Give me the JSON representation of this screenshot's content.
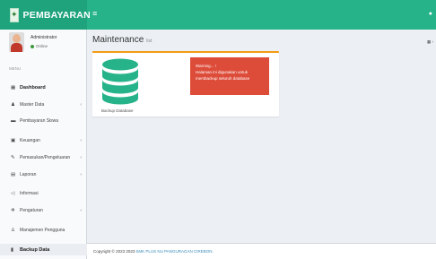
{
  "brand": {
    "title": "PEMBAYARAN"
  },
  "user": {
    "name": "Administrator",
    "status": "Online"
  },
  "sidebar": {
    "header": "MENU",
    "items": [
      {
        "label": "Dashboard",
        "icon": "dashboard-icon",
        "chevron": false
      },
      {
        "label": "Master Data",
        "icon": "users-icon",
        "chevron": true
      },
      {
        "label": "Pembayaran Siswa",
        "icon": "payment-card-icon",
        "chevron": false
      },
      {
        "label": "Keuangan",
        "icon": "money-icon",
        "chevron": true
      },
      {
        "label": "Pemasukan/Pengeluaran",
        "icon": "edit-icon",
        "chevron": true
      },
      {
        "label": "Laporan",
        "icon": "report-icon",
        "chevron": true
      },
      {
        "label": "Informasi",
        "icon": "bullhorn-icon",
        "chevron": false
      },
      {
        "label": "Pengaturan",
        "icon": "gear-icon",
        "chevron": true
      },
      {
        "label": "Manajemen Pengguna",
        "icon": "user-icon",
        "chevron": false
      },
      {
        "label": "Backup Data",
        "icon": "database-icon",
        "chevron": false
      }
    ]
  },
  "page": {
    "title": "Maintenance",
    "subtitle": "list"
  },
  "backup_tile": {
    "caption": "Backup Database"
  },
  "alert": {
    "title": "Warning... !",
    "line1": "Halaman ini digunakan untuk",
    "line2": "membackup seluruh database"
  },
  "footer": {
    "prefix": "Copyright © 2023 2023",
    "link": "SMK PLUS NU PANGURAGAN CIREBON."
  },
  "colors": {
    "topbar": "#26b38a",
    "brand_bg": "#1fa37d",
    "alert_bg": "#dd4b39",
    "box_border": "#f39c12",
    "database_icon": "#26b38a"
  }
}
